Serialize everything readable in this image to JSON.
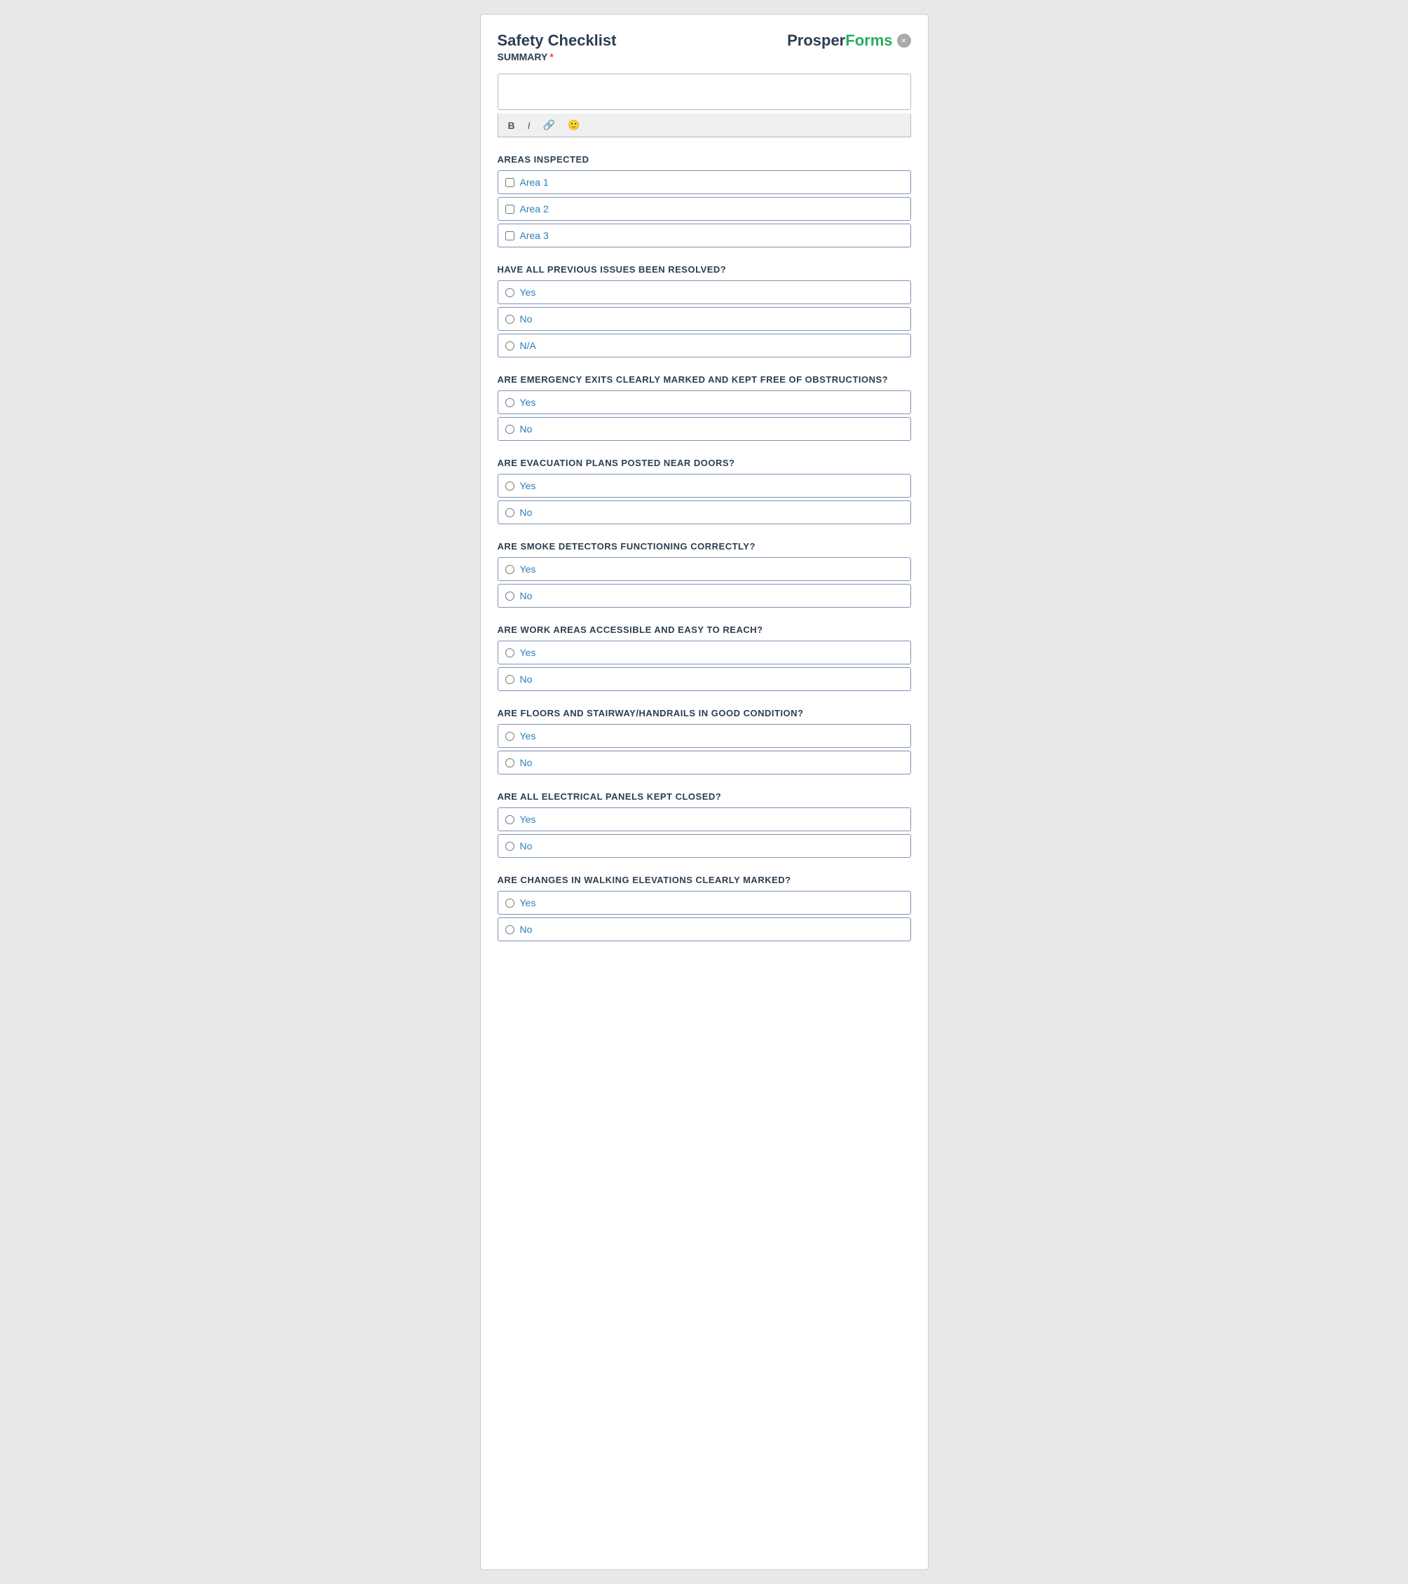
{
  "header": {
    "title": "Safety Checklist",
    "subtitle": "SUMMARY",
    "required": "*",
    "logo_prosper": "Prosper",
    "logo_forms": "Forms",
    "close_label": "×"
  },
  "toolbar": {
    "bold": "B",
    "italic": "I",
    "link": "🔗",
    "emoji": "🙂"
  },
  "sections": [
    {
      "id": "areas_inspected",
      "label": "AREAS INSPECTED",
      "type": "checkbox",
      "options": [
        "Area 1",
        "Area 2",
        "Area 3"
      ]
    },
    {
      "id": "previous_issues",
      "label": "HAVE ALL PREVIOUS ISSUES BEEN RESOLVED?",
      "type": "radio",
      "options": [
        "Yes",
        "No",
        "N/A"
      ]
    },
    {
      "id": "emergency_exits",
      "label": "ARE EMERGENCY EXITS CLEARLY MARKED AND KEPT FREE OF OBSTRUCTIONS?",
      "type": "radio",
      "options": [
        "Yes",
        "No"
      ]
    },
    {
      "id": "evacuation_plans",
      "label": "ARE EVACUATION PLANS POSTED NEAR DOORS?",
      "type": "radio",
      "options": [
        "Yes",
        "No"
      ]
    },
    {
      "id": "smoke_detectors",
      "label": "ARE SMOKE DETECTORS FUNCTIONING CORRECTLY?",
      "type": "radio",
      "options": [
        "Yes",
        "No"
      ]
    },
    {
      "id": "work_areas",
      "label": "ARE WORK AREAS ACCESSIBLE AND EASY TO REACH?",
      "type": "radio",
      "options": [
        "Yes",
        "No"
      ]
    },
    {
      "id": "floors_stairways",
      "label": "ARE FLOORS AND STAIRWAY/HANDRAILS IN GOOD CONDITION?",
      "type": "radio",
      "options": [
        "Yes",
        "No"
      ]
    },
    {
      "id": "electrical_panels",
      "label": "ARE ALL ELECTRICAL PANELS KEPT CLOSED?",
      "type": "radio",
      "options": [
        "Yes",
        "No"
      ]
    },
    {
      "id": "walking_elevations",
      "label": "ARE CHANGES IN WALKING ELEVATIONS CLEARLY MARKED?",
      "type": "radio",
      "options": [
        "Yes",
        "No"
      ]
    }
  ]
}
